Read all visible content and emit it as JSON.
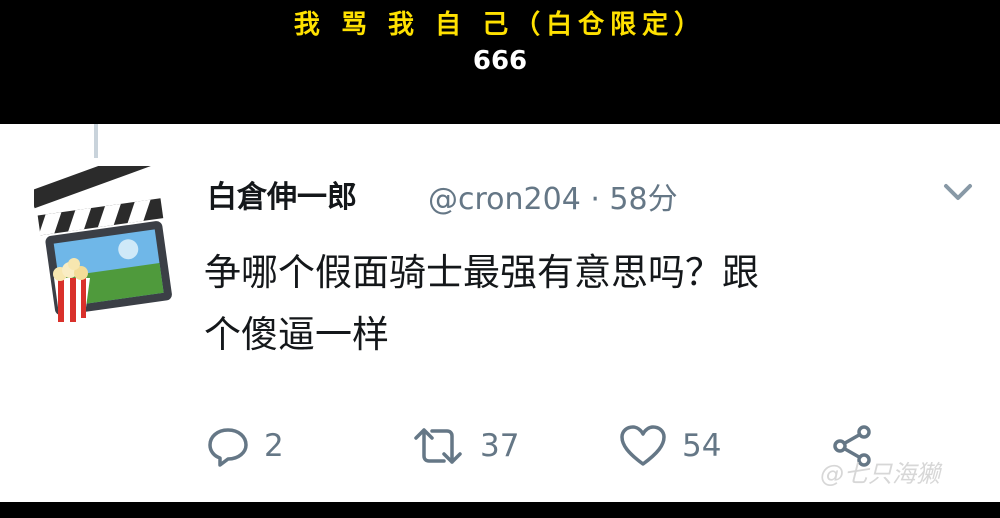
{
  "caption": {
    "line1": "我 骂 我 自 己（白仓限定）",
    "line2": "666"
  },
  "tweet": {
    "display_name": "白倉伸一郎",
    "handle_time": "@cron204 · 58分",
    "text_line1": "争哪个假面骑士最强有意思吗？跟",
    "text_line2": "个傻逼一样",
    "replies": "2",
    "retweets": "37",
    "likes": "54"
  },
  "watermark": "@七只海獭",
  "icons": {
    "avatar": "movie-clapperboard-popcorn-icon",
    "more": "chevron-down-icon",
    "reply": "reply-bubble-icon",
    "retweet": "retweet-icon",
    "like": "heart-icon",
    "share": "share-icon"
  },
  "colors": {
    "caption_yellow": "#ffe100",
    "text": "#14171a",
    "muted": "#657786"
  }
}
